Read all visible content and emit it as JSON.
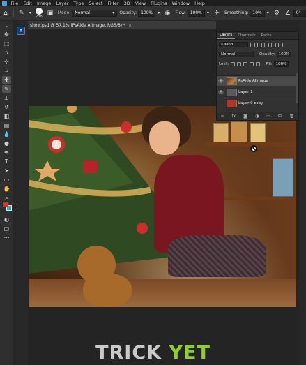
{
  "menu": [
    "File",
    "Edit",
    "Image",
    "Layer",
    "Type",
    "Select",
    "Filter",
    "3D",
    "View",
    "Plugins",
    "Window",
    "Help"
  ],
  "options": {
    "brush_size": "238",
    "mode_label": "Mode:",
    "mode_value": "Normal",
    "opacity_label": "Opacity:",
    "opacity_value": "100%",
    "flow_label": "Flow:",
    "flow_value": "100%",
    "smoothing_label": "Smoothing:",
    "smoothing_value": "10%",
    "angle_value": "0°"
  },
  "document": {
    "tab_title": "show.psd @ 57.1% (PsAide AIImage, RGB/8) *",
    "close": "×"
  },
  "layers_panel": {
    "tabs": [
      "Layers",
      "Channels",
      "Paths"
    ],
    "filter_label": "Kind",
    "blend_mode": "Normal",
    "opacity_label": "Opacity:",
    "opacity_value": "100%",
    "lock_label": "Lock:",
    "fill_label": "Fill:",
    "fill_value": "100%",
    "layers": [
      {
        "name": "PsAide AIImage",
        "visible": true,
        "selected": true
      },
      {
        "name": "Layer 1",
        "visible": true,
        "selected": false
      },
      {
        "name": "Layer 0 copy",
        "visible": false,
        "selected": false
      }
    ]
  },
  "caption": {
    "word1": "TRICK",
    "word2": "YET",
    "color1": "#c9c9c9",
    "color2": "#8fcf2a"
  },
  "colors": {
    "foreground": "#e32a1e",
    "background": "#2bb5c4",
    "accent": "#31a8ff"
  }
}
